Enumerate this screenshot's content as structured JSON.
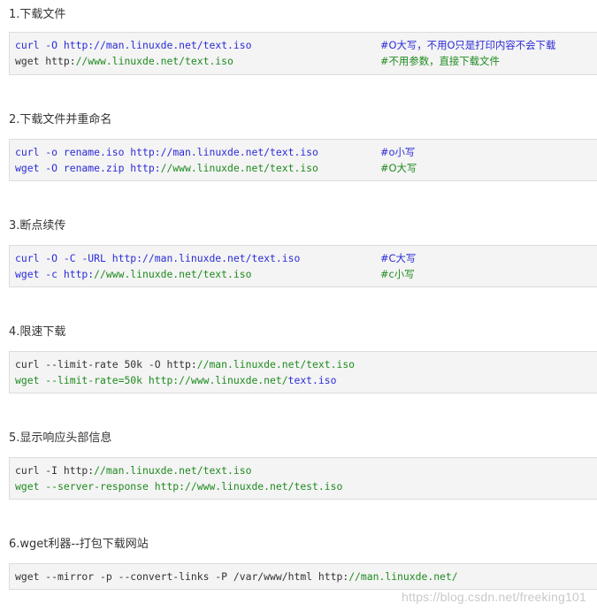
{
  "sections": [
    {
      "heading": "1.下载文件",
      "lines": [
        {
          "cmd": "curl -O ",
          "url_pre": "http://",
          "url": "man.linuxde.net/text.iso",
          "comment": "#O大写，不用O只是打印内容不会下载"
        },
        {
          "cmd": "wget http:",
          "url_pre": "",
          "url": "//www.linuxde.net/text.iso",
          "comment": "#不用参数，直接下载文件"
        }
      ]
    },
    {
      "heading": "2.下载文件并重命名",
      "lines": [
        {
          "cmd": "curl -o rename.iso http://",
          "url_pre": "",
          "url": "man.linuxde.net/text.iso",
          "comment": "#o小写"
        },
        {
          "cmd": "wget -O rename.zip http:",
          "url_pre": "",
          "url": "//www.linuxde.net/text.iso",
          "comment": "#O大写"
        }
      ]
    },
    {
      "heading": "3.断点续传",
      "lines": [
        {
          "cmd": "curl -O -C -URL http://",
          "url_pre": "",
          "url": "man.linuxde.net/text.iso",
          "comment": "#C大写"
        },
        {
          "cmd": "wget -c http:",
          "url_pre": "",
          "url": "//www.linuxde.net/text.iso",
          "comment": "#c小写"
        }
      ]
    },
    {
      "heading": "4.限速下载",
      "lines": [
        {
          "cmd": "curl --limit-rate 50k -O http:",
          "url_pre": "",
          "url": "//man.linuxde.net/text.iso",
          "comment": ""
        },
        {
          "cmd": "wget --limit-rate=50k http://www.linuxde.net/",
          "url_pre": "",
          "url": "text.iso",
          "comment": ""
        }
      ]
    },
    {
      "heading": "5.显示响应头部信息",
      "lines": [
        {
          "cmd": "curl -I http:",
          "url_pre": "",
          "url": "//man.linuxde.net/text.iso",
          "comment": ""
        },
        {
          "cmd": "wget --server-response http://www.linuxde.net/test.iso",
          "url_pre": "",
          "url": "",
          "comment": ""
        }
      ]
    },
    {
      "heading": "6.wget利器--打包下载网站",
      "lines": [
        {
          "cmd": "wget --mirror -p --convert-links -P /var/www/html http:",
          "url_pre": "",
          "url": "//man.linuxde.net/",
          "comment": ""
        }
      ]
    }
  ],
  "watermark": "https://blog.csdn.net/freeking101"
}
